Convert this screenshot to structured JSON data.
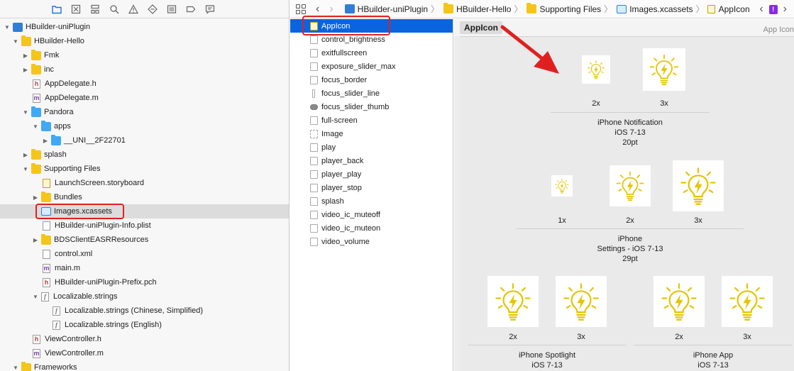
{
  "navigator": {
    "toolbar_icons": [
      "folder-icon",
      "source-control-icon",
      "symbol-icon",
      "search-icon",
      "warning-icon",
      "test-icon",
      "debug-icon",
      "breakpoint-icon",
      "report-icon"
    ],
    "items": [
      {
        "label": "HBuilder-uniPlugin",
        "icon": "project-icon"
      },
      {
        "label": "HBuilder-Hello",
        "icon": "folder-icon"
      },
      {
        "label": "Fmk",
        "icon": "folder-icon"
      },
      {
        "label": "inc",
        "icon": "folder-icon"
      },
      {
        "label": "AppDelegate.h",
        "icon": "header-file-icon"
      },
      {
        "label": "AppDelegate.m",
        "icon": "objc-file-icon"
      },
      {
        "label": "Pandora",
        "icon": "blue-folder-icon"
      },
      {
        "label": "apps",
        "icon": "blue-folder-icon"
      },
      {
        "label": "__UNI__2F22701",
        "icon": "blue-folder-icon"
      },
      {
        "label": "splash",
        "icon": "folder-icon"
      },
      {
        "label": "Supporting Files",
        "icon": "folder-icon"
      },
      {
        "label": "LaunchScreen.storyboard",
        "icon": "storyboard-file-icon"
      },
      {
        "label": "Bundles",
        "icon": "folder-icon"
      },
      {
        "label": "Images.xcassets",
        "icon": "asset-catalog-icon"
      },
      {
        "label": "HBuilder-uniPlugin-Info.plist",
        "icon": "plist-file-icon"
      },
      {
        "label": "BDSClientEASRResources",
        "icon": "folder-icon"
      },
      {
        "label": "control.xml",
        "icon": "xml-file-icon"
      },
      {
        "label": "main.m",
        "icon": "objc-file-icon"
      },
      {
        "label": "HBuilder-uniPlugin-Prefix.pch",
        "icon": "header-file-icon"
      },
      {
        "label": "Localizable.strings",
        "icon": "strings-file-icon"
      },
      {
        "label": "Localizable.strings (Chinese, Simplified)",
        "icon": "strings-file-icon"
      },
      {
        "label": "Localizable.strings (English)",
        "icon": "strings-file-icon"
      },
      {
        "label": "ViewController.h",
        "icon": "header-file-icon"
      },
      {
        "label": "ViewController.m",
        "icon": "objc-file-icon"
      },
      {
        "label": "Frameworks",
        "icon": "folder-icon"
      }
    ]
  },
  "jumpbar": {
    "crumbs": [
      "HBuilder-uniPlugin",
      "HBuilder-Hello",
      "Supporting Files",
      "Images.xcassets",
      "AppIcon"
    ],
    "warning_badge": "!"
  },
  "assets": {
    "items": [
      {
        "label": "AppIcon"
      },
      {
        "label": "control_brightness"
      },
      {
        "label": "exitfullscreen"
      },
      {
        "label": "exposure_slider_max"
      },
      {
        "label": "focus_border"
      },
      {
        "label": "focus_slider_line"
      },
      {
        "label": "focus_slider_thumb"
      },
      {
        "label": "full-screen"
      },
      {
        "label": "Image"
      },
      {
        "label": "play"
      },
      {
        "label": "player_back"
      },
      {
        "label": "player_play"
      },
      {
        "label": "player_stop"
      },
      {
        "label": "splash"
      },
      {
        "label": "video_ic_muteoff"
      },
      {
        "label": "video_ic_muteon"
      },
      {
        "label": "video_volume"
      }
    ]
  },
  "detail": {
    "set_name": "AppIcon",
    "set_type": "App Icon",
    "groups": [
      {
        "title_lines": [
          "iPhone Notification",
          "iOS 7-13",
          "20pt"
        ],
        "scales": [
          "2x",
          "3x"
        ]
      },
      {
        "title_lines": [
          "iPhone",
          "Settings - iOS 7-13",
          "29pt"
        ],
        "scales": [
          "1x",
          "2x",
          "3x"
        ]
      },
      {
        "title_lines": [
          "iPhone Spotlight",
          "iOS 7-13"
        ],
        "scales": [
          "2x",
          "3x"
        ]
      },
      {
        "title_lines": [
          "iPhone App",
          "iOS 7-13"
        ],
        "scales": [
          "2x",
          "3x"
        ]
      }
    ]
  },
  "colors": {
    "annotation_red": "#e02020",
    "selection_blue": "#0a64e0",
    "icon_yellow": "#e6c400"
  }
}
